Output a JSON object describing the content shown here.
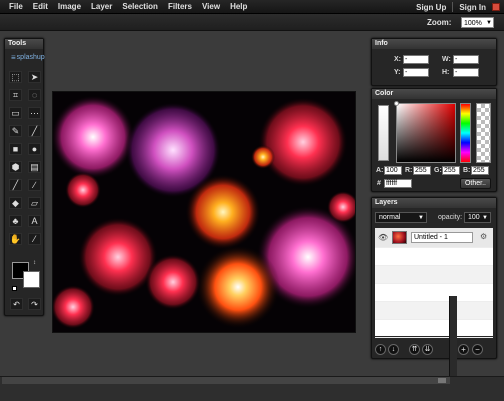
{
  "menu": {
    "items": [
      "File",
      "Edit",
      "Image",
      "Layer",
      "Selection",
      "Filters",
      "View",
      "Help"
    ],
    "signup": "Sign Up",
    "signin": "Sign In"
  },
  "zoom": {
    "label": "Zoom:",
    "value": "100%"
  },
  "tools": {
    "title": "Tools",
    "brand": "splashup",
    "items": [
      {
        "icon": "marquee-icon",
        "glyph": "⬚"
      },
      {
        "icon": "arrow-cursor-icon",
        "glyph": "➤"
      },
      {
        "icon": "crop-icon",
        "glyph": "⌗"
      },
      {
        "icon": "lasso-icon",
        "glyph": "◌"
      },
      {
        "icon": "rect-select-icon",
        "glyph": "▭"
      },
      {
        "icon": "magic-select-icon",
        "glyph": "⋯"
      },
      {
        "icon": "pencil-icon",
        "glyph": "✎"
      },
      {
        "icon": "line-icon",
        "glyph": "╱"
      },
      {
        "icon": "square-shape-icon",
        "glyph": "■"
      },
      {
        "icon": "circle-shape-icon",
        "glyph": "●"
      },
      {
        "icon": "hexagon-icon",
        "glyph": "⬢"
      },
      {
        "icon": "gradient-icon",
        "glyph": "▤"
      },
      {
        "icon": "brush-icon",
        "glyph": "╱"
      },
      {
        "icon": "smudge-icon",
        "glyph": "∕"
      },
      {
        "icon": "fill-bucket-icon",
        "glyph": "◆"
      },
      {
        "icon": "eraser-icon",
        "glyph": "▱"
      },
      {
        "icon": "stamp-icon",
        "glyph": "♣"
      },
      {
        "icon": "text-icon",
        "glyph": "A"
      },
      {
        "icon": "hand-icon",
        "glyph": "✋"
      },
      {
        "icon": "eyedropper-icon",
        "glyph": "⁄"
      }
    ]
  },
  "info": {
    "title": "Info",
    "x_label": "X:",
    "y_label": "Y:",
    "w_label": "W:",
    "h_label": "H:",
    "x_value": "-",
    "y_value": "-",
    "w_value": "-",
    "h_value": "-"
  },
  "color": {
    "title": "Color",
    "a_label": "A:",
    "a_value": "100",
    "r_label": "R:",
    "r_value": "255",
    "g_label": "G:",
    "g_value": "255",
    "b_label": "B:",
    "b_value": "255",
    "hex_label": "#",
    "hex_value": "ffffff",
    "other_button": "Other.."
  },
  "layers": {
    "title": "Layers",
    "blend_mode": "normal",
    "opacity_label": "opacity:",
    "opacity_value": "100",
    "layer_name": "Untitled - 1"
  },
  "colors": {
    "accent": "#d84c3c",
    "panel": "#262626",
    "background": "#3b3b3b"
  }
}
